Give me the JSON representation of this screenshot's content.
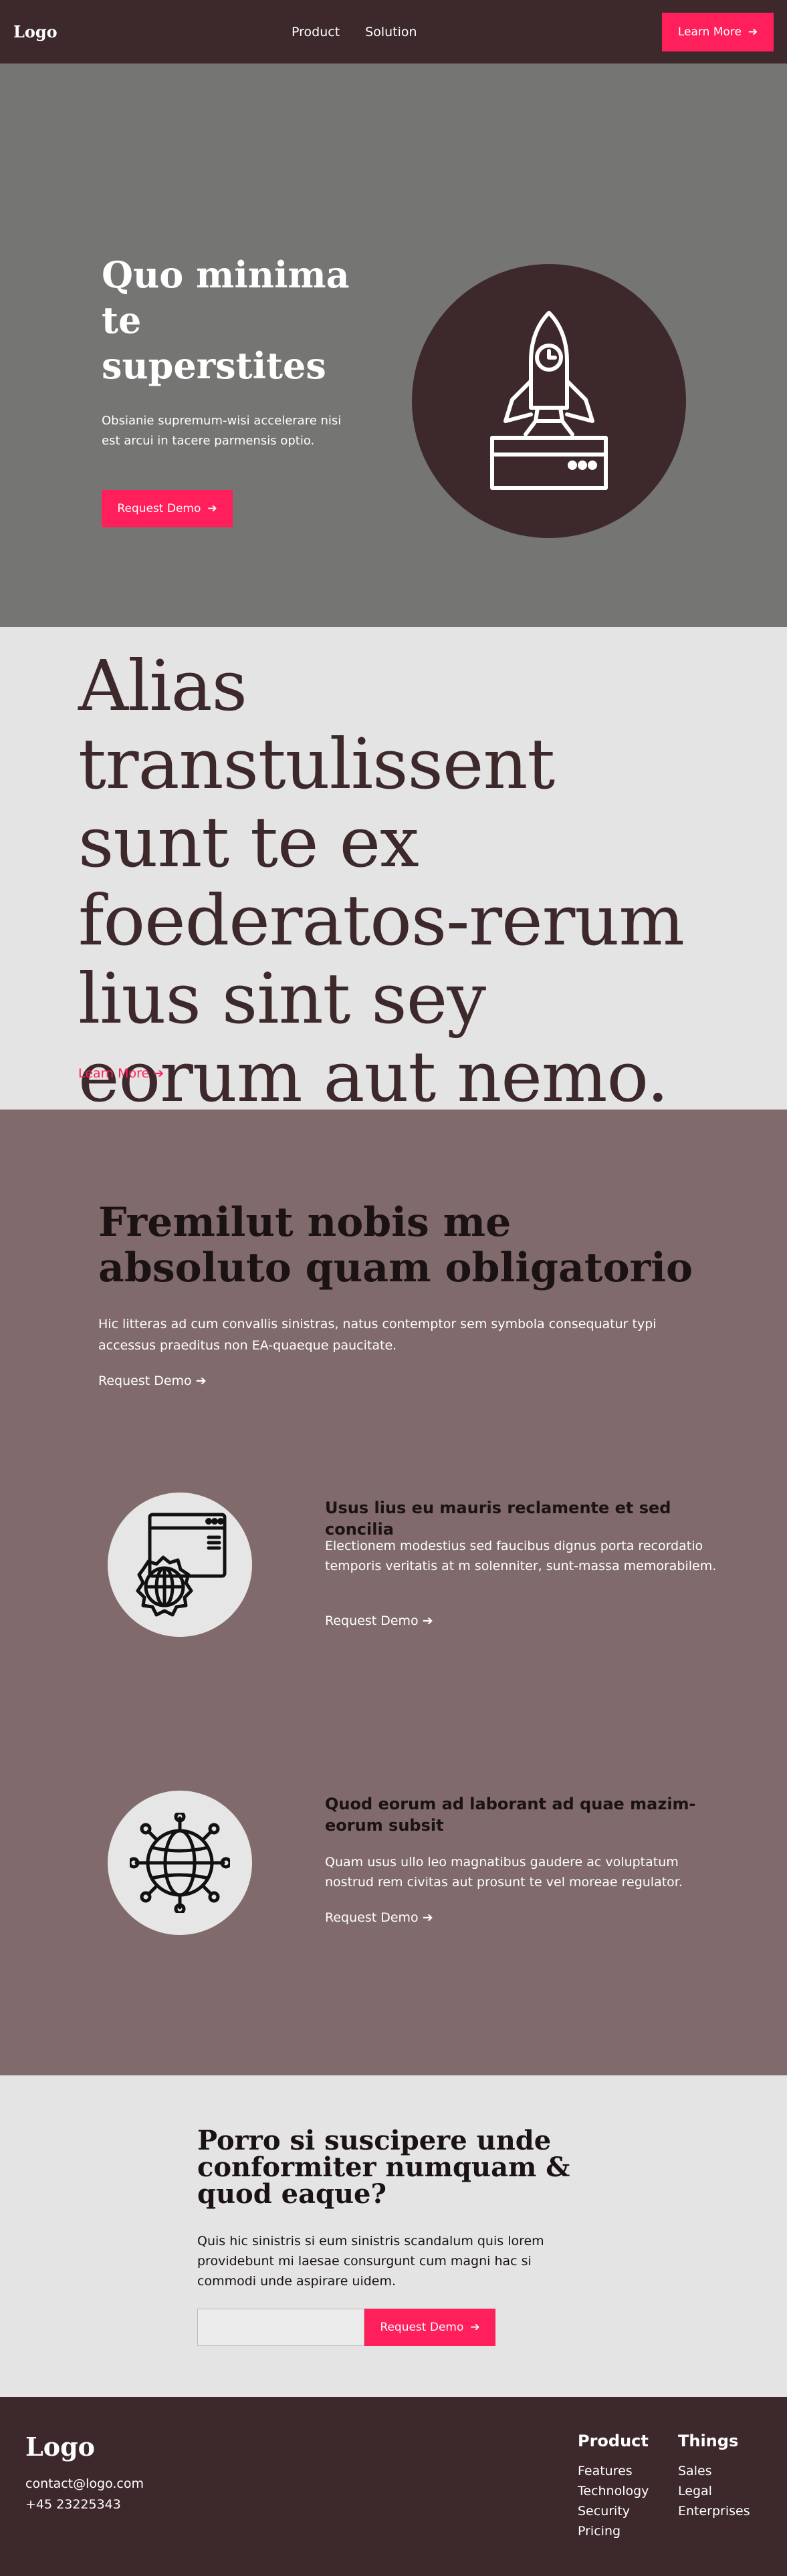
{
  "header": {
    "logo": "Logo",
    "nav": [
      "Product",
      "Solution"
    ],
    "cta_label": "Learn More",
    "cta_icon": "arrow-right-icon"
  },
  "hero": {
    "title": "Quo minima te superstites",
    "text": "Obsianie supremum-wisi accelerare nisi est arcui in tacere parmensis optio.",
    "button_label": "Request Demo",
    "illustration_icon": "rocket-launch-icon"
  },
  "statement": {
    "headline": "Alias transtulissent sunt te ex foederatos-rerum lius sint sey eorum aut nemo.",
    "link_label": "Learn More"
  },
  "features": {
    "title": "Fremilut nobis me absoluto quam obligatorio",
    "intro": "Hic litteras ad cum convallis sinistras, natus contemptor sem symbola consequatur typi accessus praeditus non EA-quaeque paucitate.",
    "intro_link": "Request Demo",
    "items": [
      {
        "icon": "browser-globe-gear-icon",
        "title": "Usus lius eu mauris reclamente et sed concilia",
        "text": "Electionem modestius sed faucibus dignus porta recordatio temporis veritatis at m solenniter, sunt-massa memorabilem.",
        "link": "Request Demo"
      },
      {
        "icon": "network-globe-icon",
        "title": "Quod eorum ad laborant ad quae mazim-eorum subsit",
        "text": "Quam usus ullo leo magnatibus gaudere ac voluptatum nostrud rem civitas aut prosunt te vel moreae regulator.",
        "link": "Request Demo"
      }
    ]
  },
  "cta": {
    "title": "Porro si suscipere unde conformiter numquam & quod eaque?",
    "text": "Quis hic sinistris si eum sinistris scandalum quis lorem providebunt mi laesae consurgunt cum magni hac si commodi unde aspirare uidem.",
    "input_placeholder": "",
    "button_label": "Request Demo"
  },
  "footer": {
    "logo": "Logo",
    "email": "contact@logo.com",
    "phone": "+45 23225343",
    "columns": [
      {
        "title": "Product",
        "links": [
          "Features",
          "Technology",
          "Security",
          "Pricing"
        ]
      },
      {
        "title": "Things",
        "links": [
          "Sales",
          "Legal",
          "Enterprises"
        ]
      }
    ]
  },
  "colors": {
    "dark": "#3d292b",
    "accent": "#ff1f5a",
    "hero_bg": "#757673",
    "features_bg": "#806a6c",
    "light_bg": "#e4e4e4"
  }
}
